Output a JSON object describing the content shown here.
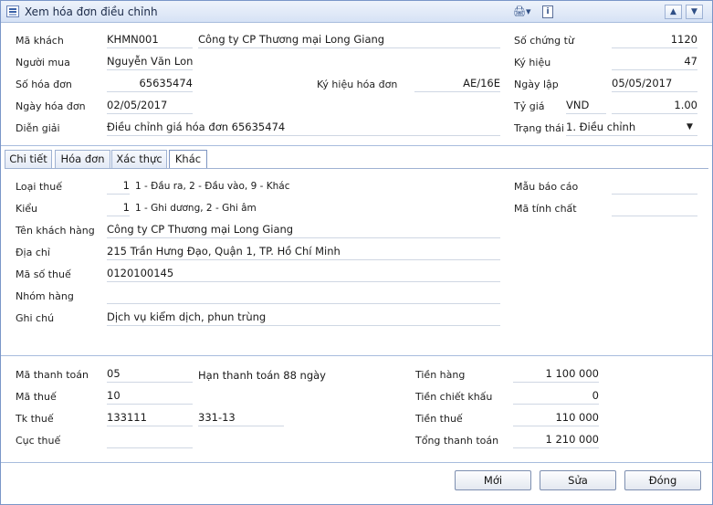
{
  "window": {
    "title": "Xem hóa đơn điều chỉnh",
    "icons": {
      "print": "printer-icon",
      "info": "info-icon",
      "prev": "up-arrow-icon",
      "next": "down-arrow-icon"
    }
  },
  "header": {
    "ma_khach_label": "Mã khách",
    "ma_khach": "KHMN001",
    "ten_khach": "Công ty CP Thương mại Long Giang",
    "nguoi_mua_label": "Người mua",
    "nguoi_mua": "Nguyễn Văn Lon",
    "so_hoa_don_label": "Số hóa đơn",
    "so_hoa_don": "65635474",
    "ky_hieu_hd_label": "Ký hiệu hóa đơn",
    "ky_hieu_hd": "AE/16E",
    "ngay_hoa_don_label": "Ngày hóa đơn",
    "ngay_hoa_don": "02/05/2017",
    "dien_giai_label": "Diễn giải",
    "dien_giai": "Điều chỉnh giá hóa đơn 65635474",
    "so_chung_tu_label": "Số chứng từ",
    "so_chung_tu": "1120",
    "ky_hieu_label": "Ký hiệu",
    "ky_hieu": "47",
    "ngay_lap_label": "Ngày lập",
    "ngay_lap": "05/05/2017",
    "ty_gia_label": "Tỷ giá",
    "tien_te": "VND",
    "ty_gia": "1.00",
    "trang_thai_label": "Trạng thái",
    "trang_thai": "1. Điều chỉnh",
    "dropdown_arrow": "▼"
  },
  "tabs": [
    {
      "label": "Chi tiết"
    },
    {
      "label": "Hóa đơn"
    },
    {
      "label": "Xác thực"
    },
    {
      "label": "Khác"
    }
  ],
  "khac": {
    "loai_thue_label": "Loại thuế",
    "loai_thue": "1",
    "loai_thue_hint": "1 - Đầu ra, 2 - Đầu vào, 9 - Khác",
    "kieu_label": "Kiểu",
    "kieu": "1",
    "kieu_hint": "1 - Ghi dương, 2 - Ghi âm",
    "ten_kh_label": "Tên khách hàng",
    "ten_kh": "Công ty CP Thương mại Long Giang",
    "dia_chi_label": "Địa chỉ",
    "dia_chi": "215 Trần Hưng Đạo, Quận 1, TP. Hồ Chí Minh",
    "mst_label": "Mã số thuế",
    "mst": "0120100145",
    "nhom_hang_label": "Nhóm hàng",
    "nhom_hang": "",
    "ghi_chu_label": "Ghi chú",
    "ghi_chu": "Dịch vụ kiểm dịch, phun trùng",
    "mau_bao_cao_label": "Mẫu báo cáo",
    "mau_bao_cao": "",
    "ma_tinh_chat_label": "Mã tính chất",
    "ma_tinh_chat": ""
  },
  "footer": {
    "ma_tt_label": "Mã thanh toán",
    "ma_tt": "05",
    "han_tt": "Hạn thanh toán 88 ngày",
    "ma_thue_label": "Mã thuế",
    "ma_thue": "10",
    "tk_thue_label": "Tk thuế",
    "tk_thue": "133111",
    "tk_thue2": "331-13",
    "cuc_thue_label": "Cục thuế",
    "cuc_thue": "",
    "tien_hang_label": "Tiền hàng",
    "tien_hang": "1 100 000",
    "tien_ck_label": "Tiền chiết khấu",
    "tien_ck": "0",
    "tien_thue_label": "Tiền thuế",
    "tien_thue": "110 000",
    "tong_tt_label": "Tổng thanh toán",
    "tong_tt": "1 210 000"
  },
  "buttons": {
    "moi": "Mới",
    "sua": "Sửa",
    "dong": "Đóng"
  }
}
